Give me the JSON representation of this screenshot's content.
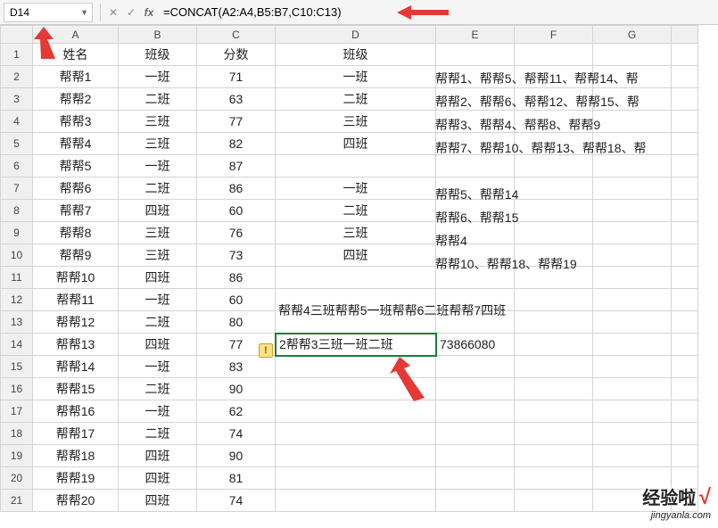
{
  "namebox": "D14",
  "formula": "=CONCAT(A2:A4,B5:B7,C10:C13)",
  "colHeaders": [
    "A",
    "B",
    "C",
    "D",
    "E",
    "F",
    "G"
  ],
  "rows": [
    {
      "n": 1,
      "A": "姓名",
      "B": "班级",
      "C": "分数",
      "D": "班级"
    },
    {
      "n": 2,
      "A": "帮帮1",
      "B": "一班",
      "C": "71",
      "D": "一班",
      "E_over": "帮帮1、帮帮5、帮帮11、帮帮14、帮"
    },
    {
      "n": 3,
      "A": "帮帮2",
      "B": "二班",
      "C": "63",
      "D": "二班",
      "E_over": "帮帮2、帮帮6、帮帮12、帮帮15、帮"
    },
    {
      "n": 4,
      "A": "帮帮3",
      "B": "三班",
      "C": "77",
      "D": "三班",
      "E_over": "帮帮3、帮帮4、帮帮8、帮帮9"
    },
    {
      "n": 5,
      "A": "帮帮4",
      "B": "三班",
      "C": "82",
      "D": "四班",
      "E_over": "帮帮7、帮帮10、帮帮13、帮帮18、帮"
    },
    {
      "n": 6,
      "A": "帮帮5",
      "B": "一班",
      "C": "87"
    },
    {
      "n": 7,
      "A": "帮帮6",
      "B": "二班",
      "C": "86",
      "D": "一班",
      "E_over": "帮帮5、帮帮14"
    },
    {
      "n": 8,
      "A": "帮帮7",
      "B": "四班",
      "C": "60",
      "D": "二班",
      "E_over": "帮帮6、帮帮15"
    },
    {
      "n": 9,
      "A": "帮帮8",
      "B": "三班",
      "C": "76",
      "D": "三班",
      "E_over": "帮帮4"
    },
    {
      "n": 10,
      "A": "帮帮9",
      "B": "三班",
      "C": "73",
      "D": "四班",
      "E_over": "帮帮10、帮帮18、帮帮19"
    },
    {
      "n": 11,
      "A": "帮帮10",
      "B": "四班",
      "C": "86"
    },
    {
      "n": 12,
      "A": "帮帮11",
      "B": "一班",
      "C": "60",
      "D_over": "帮帮4三班帮帮5一班帮帮6二班帮帮7四班"
    },
    {
      "n": 13,
      "A": "帮帮12",
      "B": "二班",
      "C": "80"
    },
    {
      "n": 14,
      "A": "帮帮13",
      "B": "四班",
      "C": "77",
      "D_sel": "2帮帮3三班一班二班",
      "E": "73866080"
    },
    {
      "n": 15,
      "A": "帮帮14",
      "B": "一班",
      "C": "83"
    },
    {
      "n": 16,
      "A": "帮帮15",
      "B": "二班",
      "C": "90"
    },
    {
      "n": 17,
      "A": "帮帮16",
      "B": "一班",
      "C": "62"
    },
    {
      "n": 18,
      "A": "帮帮17",
      "B": "二班",
      "C": "74"
    },
    {
      "n": 19,
      "A": "帮帮18",
      "B": "四班",
      "C": "90"
    },
    {
      "n": 20,
      "A": "帮帮19",
      "B": "四班",
      "C": "81"
    },
    {
      "n": 21,
      "A": "帮帮20",
      "B": "四班",
      "C": "74"
    }
  ],
  "watermark": {
    "main": "经验啦",
    "sub": "jingyanla.com",
    "check": "√"
  },
  "icons": {
    "cancel": "✕",
    "confirm": "✓",
    "fx": "fx",
    "dd": "▼"
  }
}
